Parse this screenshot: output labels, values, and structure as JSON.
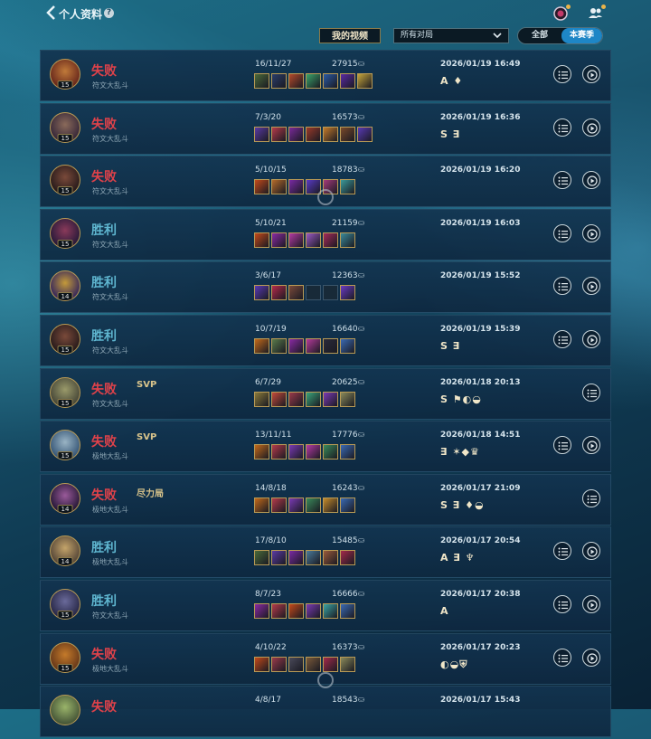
{
  "header": {
    "title": "个人资料",
    "help": "?"
  },
  "filters": {
    "my_video": "我的视频",
    "match_type": "所有对局",
    "toggle_all": "全部",
    "toggle_season": "本赛季"
  },
  "colors": {
    "lose": "#e0424a",
    "win": "#5fb6d0",
    "accent": "#1e86c6"
  },
  "matches": [
    {
      "result": "失败",
      "outcome": "lose",
      "mode": "符文大乱斗",
      "level": "15",
      "badge": "",
      "kda": "16/11/27",
      "gold": "27915",
      "date": "2026/01/19 16:49",
      "grades": "A ♦",
      "replay": true,
      "avatar": [
        "#6b2a1c",
        "#c07a3a"
      ],
      "items": [
        "#4a6a3a",
        "#2a3c6a",
        "#b44a2a",
        "#3aa46a",
        "#2a5aa4",
        "#5a2aa4",
        "#c4a43a"
      ]
    },
    {
      "result": "失败",
      "outcome": "lose",
      "mode": "符文大乱斗",
      "level": "15",
      "badge": "",
      "kda": "7/3/20",
      "gold": "16573",
      "date": "2026/01/19 16:36",
      "grades": "S ∃",
      "replay": true,
      "avatar": [
        "#3a2a3a",
        "#8a6a5a"
      ],
      "items": [
        "#5a3aa4",
        "#b43a4a",
        "#7a2a9a",
        "#9a3a2a",
        "#c47a2a",
        "#7a4a2a",
        "#5a3ab4"
      ]
    },
    {
      "result": "失败",
      "outcome": "lose",
      "mode": "符文大乱斗",
      "level": "15",
      "badge": "",
      "kda": "5/10/15",
      "gold": "18783",
      "date": "2026/01/19 16:20",
      "grades": "",
      "replay": true,
      "avatar": [
        "#2a1c1c",
        "#7a4a3a"
      ],
      "items": [
        "#c44a1a",
        "#b46a2a",
        "#7a2aa4",
        "#5a3ac4",
        "#a43a7a",
        "#3a9a9a"
      ]
    },
    {
      "result": "胜利",
      "outcome": "win",
      "mode": "符文大乱斗",
      "level": "15",
      "badge": "",
      "kda": "5/10/21",
      "gold": "21159",
      "date": "2026/01/19 16:03",
      "grades": "",
      "replay": true,
      "avatar": [
        "#2a1a3a",
        "#8a3a5a"
      ],
      "items": [
        "#c44a1a",
        "#8a2aa4",
        "#b43aa4",
        "#9a5ac4",
        "#a42a5a",
        "#3a8a9a"
      ]
    },
    {
      "result": "胜利",
      "outcome": "win",
      "mode": "符文大乱斗",
      "level": "14",
      "badge": "",
      "kda": "3/6/17",
      "gold": "12363",
      "date": "2026/01/19 15:52",
      "grades": "",
      "replay": true,
      "avatar": [
        "#3a2a5a",
        "#c49a3a"
      ],
      "items": [
        "#5a3ab4",
        "#b42a4a",
        "#7a4a3a",
        "",
        "",
        "#6a3ac4"
      ]
    },
    {
      "result": "胜利",
      "outcome": "win",
      "mode": "符文大乱斗",
      "level": "15",
      "badge": "",
      "kda": "10/7/19",
      "gold": "16640",
      "date": "2026/01/19 15:39",
      "grades": "S ∃",
      "replay": true,
      "avatar": [
        "#2a1c1c",
        "#7a4a3a"
      ],
      "items": [
        "#c46a1a",
        "#5a7a4a",
        "#8a2aa4",
        "#b43a9a",
        "#2a2a3a",
        "#3a6ab4"
      ]
    },
    {
      "result": "失败",
      "outcome": "lose",
      "mode": "符文大乱斗",
      "level": "15",
      "badge": "SVP",
      "kda": "6/7/29",
      "gold": "20625",
      "date": "2026/01/18 20:13",
      "grades": "S ⚑◐◒",
      "replay": false,
      "avatar": [
        "#4a4a3a",
        "#9a9a6a"
      ],
      "items": [
        "#8a7a3a",
        "#c44a3a",
        "#9a3a4a",
        "#3aa47a",
        "#7a3ab4",
        "#8a8a5a"
      ]
    },
    {
      "result": "失败",
      "outcome": "lose",
      "mode": "极地大乱斗",
      "level": "15",
      "badge": "SVP",
      "kda": "13/11/11",
      "gold": "17776",
      "date": "2026/01/18 14:51",
      "grades": "∃ ✶◆♛",
      "replay": true,
      "avatar": [
        "#3a5a7a",
        "#9ab4c4"
      ],
      "items": [
        "#c46a1a",
        "#b43a4a",
        "#7a3ab4",
        "#b43aa4",
        "#3a8a5a",
        "#3a6ab4"
      ]
    },
    {
      "result": "失败",
      "outcome": "lose",
      "mode": "极地大乱斗",
      "level": "14",
      "badge": "尽力局",
      "kda": "14/8/18",
      "gold": "16243",
      "date": "2026/01/17 21:09",
      "grades": "S ∃ ♦◒",
      "replay": false,
      "avatar": [
        "#2a1a3a",
        "#9a5a9a"
      ],
      "items": [
        "#c46a1a",
        "#b43a4a",
        "#7a3ab4",
        "#3a8a5a",
        "#c48a2a",
        "#3a6ab4"
      ]
    },
    {
      "result": "胜利",
      "outcome": "win",
      "mode": "极地大乱斗",
      "level": "14",
      "badge": "",
      "kda": "17/8/10",
      "gold": "15485",
      "date": "2026/01/17 20:54",
      "grades": "A ∃ ♆",
      "replay": true,
      "avatar": [
        "#5a4a3a",
        "#c4a46a"
      ],
      "items": [
        "#4a6a3a",
        "#5a3aa4",
        "#7a2aa4",
        "#4a7a9a",
        "#9a5a3a",
        "#a42a4a"
      ]
    },
    {
      "result": "胜利",
      "outcome": "win",
      "mode": "符文大乱斗",
      "level": "15",
      "badge": "",
      "kda": "8/7/23",
      "gold": "16666",
      "date": "2026/01/17 20:38",
      "grades": "A",
      "replay": true,
      "avatar": [
        "#2a2a4a",
        "#6a6a9a"
      ],
      "items": [
        "#8a2aa4",
        "#b43a4a",
        "#c44a1a",
        "#7a3ab4",
        "#3aa4a4",
        "#3a6ab4"
      ]
    },
    {
      "result": "失败",
      "outcome": "lose",
      "mode": "极地大乱斗",
      "level": "15",
      "badge": "",
      "kda": "4/10/22",
      "gold": "16373",
      "date": "2026/01/17 20:23",
      "grades": "◐◒⛨",
      "replay": true,
      "avatar": [
        "#6a3a1a",
        "#c47a2a"
      ],
      "items": [
        "#c44a1a",
        "#9a3a4a",
        "#4a4a5a",
        "#7a5a3a",
        "#a42a4a",
        "#8a8a5a"
      ]
    },
    {
      "result": "失败",
      "outcome": "lose",
      "mode": "",
      "level": "",
      "badge": "",
      "kda": "4/8/17",
      "gold": "18543",
      "date": "2026/01/17 15:43",
      "grades": "",
      "replay": false,
      "avatar": [
        "#4a5a3a",
        "#9ab46a"
      ],
      "items": []
    }
  ]
}
